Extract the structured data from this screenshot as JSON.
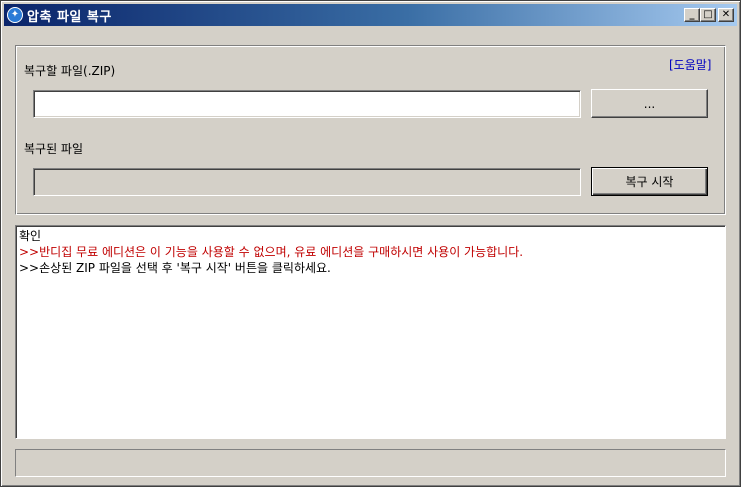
{
  "window": {
    "title": "압축 파일 복구",
    "minimize_glyph": "_",
    "maximize_glyph": "□",
    "close_glyph": "✕"
  },
  "form": {
    "source_label": "복구할 파일(.ZIP)",
    "help_link": "[도움말]",
    "source_value": "",
    "browse_label": "...",
    "dest_label": "복구된 파일",
    "dest_value": "",
    "start_label": "복구 시작"
  },
  "log": {
    "lines": [
      {
        "text": "확인",
        "color": "#000000"
      },
      {
        "text": ">>반디집 무료 에디션은 이 기능을 사용할 수 없으며, 유료 에디션을 구매하시면 사용이 가능합니다.",
        "color": "#c00000"
      },
      {
        "text": ">>손상된 ZIP 파일을 선택 후 '복구 시작' 버튼을 클릭하세요.",
        "color": "#000000"
      }
    ]
  },
  "status": {
    "text": ""
  },
  "colors": {
    "face": "#d4d0c8",
    "title_active": "#0a246a",
    "link": "#0000c0",
    "error": "#c00000"
  }
}
